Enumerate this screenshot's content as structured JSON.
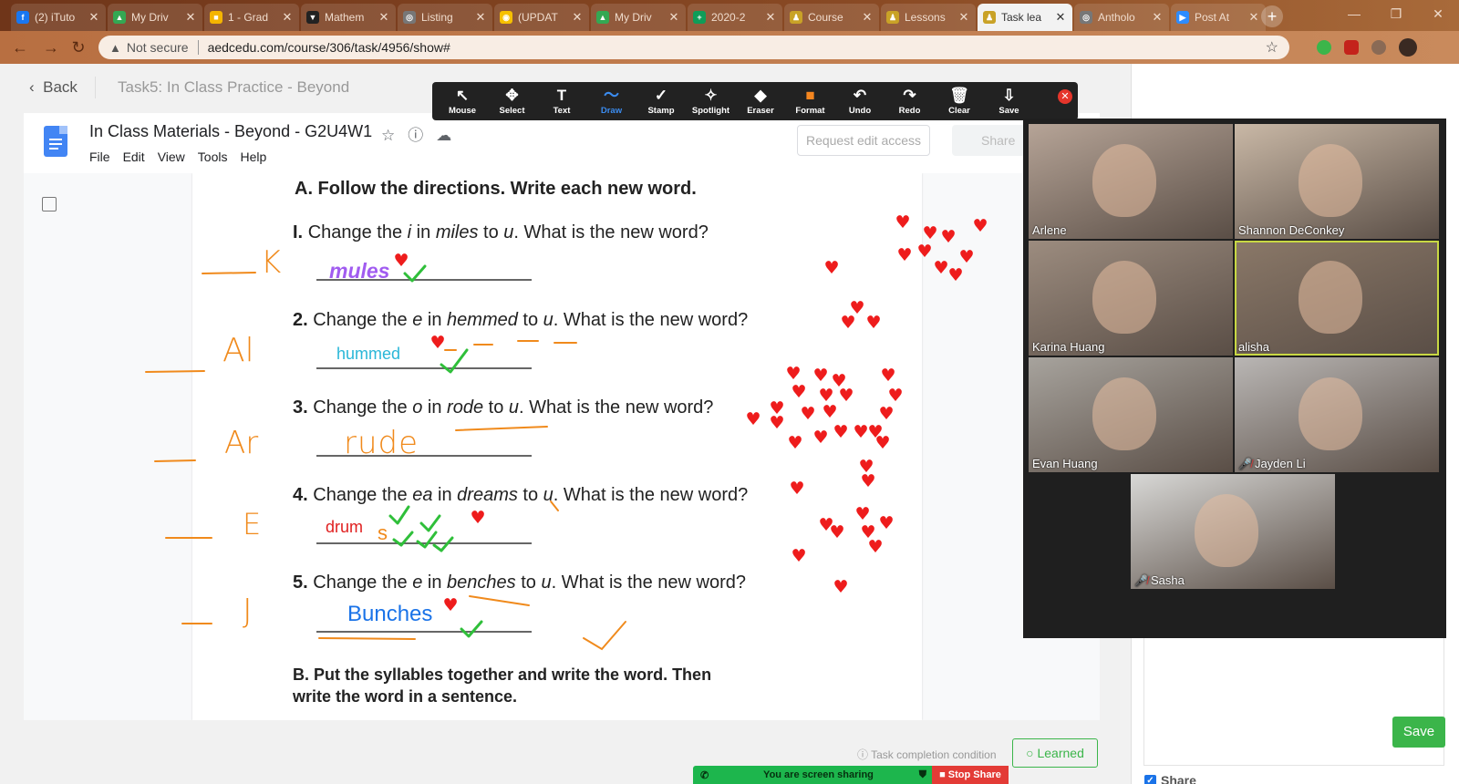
{
  "browser": {
    "tabs": [
      {
        "title": "(2) iTuto",
        "favicon_color": "#1877f2",
        "favicon_glyph": "f"
      },
      {
        "title": "My Driv",
        "favicon_color": "#34a853",
        "favicon_glyph": "▲"
      },
      {
        "title": "1 - Grad",
        "favicon_color": "#f4b400",
        "favicon_glyph": "■"
      },
      {
        "title": "Mathem",
        "favicon_color": "#222222",
        "favicon_glyph": "▼"
      },
      {
        "title": "Listing",
        "favicon_color": "#777777",
        "favicon_glyph": "◎"
      },
      {
        "title": "(UPDAT",
        "favicon_color": "#f6c000",
        "favicon_glyph": "◉"
      },
      {
        "title": "My Driv",
        "favicon_color": "#34a853",
        "favicon_glyph": "▲"
      },
      {
        "title": "2020-2",
        "favicon_color": "#0f9d58",
        "favicon_glyph": "+"
      },
      {
        "title": "Course",
        "favicon_color": "#c9a227",
        "favicon_glyph": "♟"
      },
      {
        "title": "Lessons",
        "favicon_color": "#c9a227",
        "favicon_glyph": "♟"
      },
      {
        "title": "Task lea",
        "favicon_color": "#c9a227",
        "favicon_glyph": "♟",
        "active": true
      },
      {
        "title": "Antholo",
        "favicon_color": "#777777",
        "favicon_glyph": "◎"
      },
      {
        "title": "Post At",
        "favicon_color": "#2d8cff",
        "favicon_glyph": "▶"
      }
    ],
    "new_tab": "+",
    "security_label": "Not secure",
    "url": "aedcedu.com/course/306/task/4956/show#"
  },
  "app": {
    "back_label": "Back",
    "task_title": "Task5:  In Class Practice - Beyond",
    "completion_label": "Task completion condition",
    "learned_label": "○ Learned",
    "share_label": "Share",
    "save_label": "Save"
  },
  "doc": {
    "name": "In Class Materials - Beyond - G2U4W1",
    "menu": [
      "File",
      "Edit",
      "View",
      "Tools",
      "Help"
    ],
    "request_edit": "Request edit access",
    "share": "Share",
    "section_a": "A. Follow the directions. Write each new word.",
    "questions": [
      {
        "num": "I.",
        "parts": [
          "Change the ",
          "i",
          " in ",
          "miles",
          " to ",
          "u",
          ". What is the new word?"
        ]
      },
      {
        "num": "2.",
        "parts": [
          "Change the ",
          "e",
          " in ",
          "hemmed",
          " to ",
          "u",
          ". What is the new word?"
        ]
      },
      {
        "num": "3.",
        "parts": [
          "Change the ",
          "o",
          " in ",
          "rode",
          " to ",
          "u",
          ". What is the new word?"
        ]
      },
      {
        "num": "4.",
        "parts": [
          "Change the ",
          "ea",
          " in ",
          "dreams",
          " to ",
          "u",
          ". What is the new word?"
        ]
      },
      {
        "num": "5.",
        "parts": [
          "Change the ",
          "e",
          " in ",
          "benches",
          " to ",
          "u",
          ". What is the new word?"
        ]
      }
    ],
    "answers": [
      {
        "text": "mules",
        "color": "#a15cf0"
      },
      {
        "text": "hummed",
        "color": "#2ab7d8"
      },
      {
        "text": "rude",
        "color": "#f08a1c"
      },
      {
        "text": "drum",
        "color": "#e02020"
      },
      {
        "text": "Bunches",
        "color": "#1a73e8"
      }
    ],
    "section_b_line1": "B. Put the syllables together and write the word. Then",
    "section_b_line2": "write the word in a sentence."
  },
  "annotations": {
    "margin_initials": [
      "K",
      "Al",
      "Ar",
      "E",
      "J"
    ],
    "ink_orange": "#f08a1c",
    "ink_green": "#2fbf3a",
    "ink_red": "#ee1c1c"
  },
  "zoom_toolbar": {
    "tools": [
      {
        "label": "Mouse",
        "glyph": "↖"
      },
      {
        "label": "Select",
        "glyph": "✥"
      },
      {
        "label": "Text",
        "glyph": "T"
      },
      {
        "label": "Draw",
        "glyph": "〜",
        "active": true
      },
      {
        "label": "Stamp",
        "glyph": "✓"
      },
      {
        "label": "Spotlight",
        "glyph": "✧"
      },
      {
        "label": "Eraser",
        "glyph": "◆"
      },
      {
        "label": "Format",
        "glyph": "■"
      },
      {
        "label": "Undo",
        "glyph": "↶"
      },
      {
        "label": "Redo",
        "glyph": "↷"
      },
      {
        "label": "Clear",
        "glyph": "🗑"
      },
      {
        "label": "Save",
        "glyph": "⇩"
      }
    ],
    "close": "✕"
  },
  "gallery": {
    "participants": [
      {
        "name": "Arlene",
        "bg": "#b6a497"
      },
      {
        "name": "Shannon DeConkey",
        "bg": "#c9b8a6"
      },
      {
        "name": "Karina Huang",
        "bg": "#9c8c7f"
      },
      {
        "name": "alisha",
        "bg": "#8a7868",
        "speaking": true
      },
      {
        "name": "Evan Huang",
        "bg": "#a7a39d"
      },
      {
        "name": "Jayden Li",
        "bg": "#b9b6b4",
        "muted": true
      },
      {
        "name": "Sasha",
        "bg": "#d8d8d6",
        "muted": true
      }
    ]
  },
  "screen_share": {
    "label": "You are screen sharing",
    "stop": "■ Stop Share"
  }
}
